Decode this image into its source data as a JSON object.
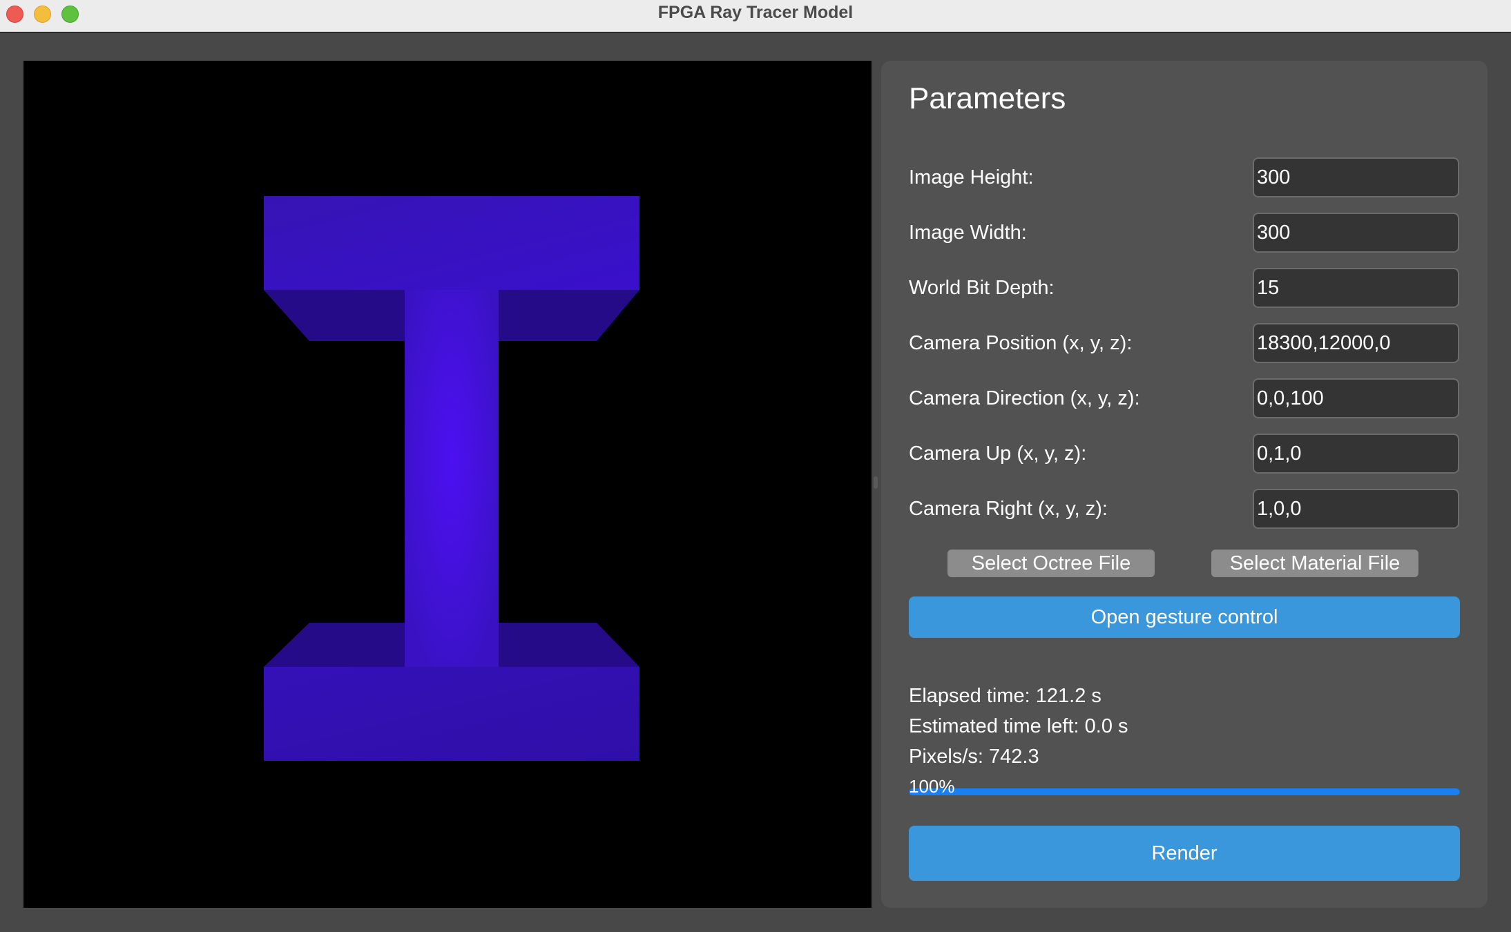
{
  "window": {
    "title": "FPGA Ray Tracer Model"
  },
  "panel": {
    "title": "Parameters",
    "params": [
      {
        "label": "Image Height:",
        "value": "300"
      },
      {
        "label": "Image Width:",
        "value": "300"
      },
      {
        "label": "World Bit Depth:",
        "value": "15"
      },
      {
        "label": "Camera Position (x, y, z):",
        "value": "18300,12000,0"
      },
      {
        "label": "Camera Direction (x, y, z):",
        "value": "0,0,100"
      },
      {
        "label": "Camera Up (x, y, z):",
        "value": "0,1,0"
      },
      {
        "label": "Camera Right (x, y, z):",
        "value": "1,0,0"
      }
    ],
    "select_octree_label": "Select Octree File",
    "select_material_label": "Select Material File",
    "gesture_label": "Open gesture control",
    "elapsed": "Elapsed time: 121.2 s",
    "estimated": "Estimated time left: 0.0 s",
    "pixels_per_sec": "Pixels/s: 742.3",
    "progress_fraction": 1.0,
    "progress_text": "100%",
    "render_label": "Render"
  },
  "render": {
    "background_color": "#000000",
    "shape": "I-beam",
    "colors": {
      "top_face": "#3a10c8",
      "side_face": "#2a0a8e",
      "web": "#4a14ec",
      "bottom_face": "#3410b4"
    }
  },
  "colors": {
    "accent_blue": "#3a97dc",
    "progress_blue": "#1a7ff0",
    "panel_bg": "#525252",
    "input_bg": "#343434"
  }
}
